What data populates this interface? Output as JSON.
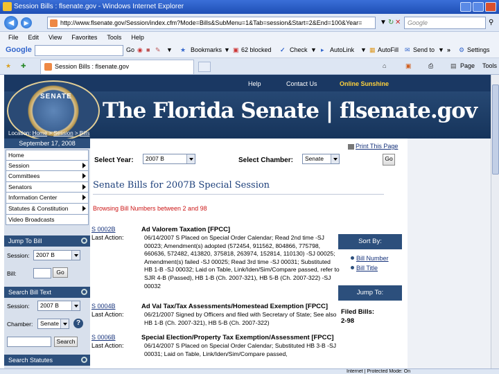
{
  "window": {
    "title": "Session Bills : flsenate.gov - Windows Internet Explorer"
  },
  "addressbar": {
    "url": "http://www.flsenate.gov/Session/index.cfm?Mode=Bills&SubMenu=1&Tab=session&Start=2&End=100&Year=",
    "search_placeholder": "Google"
  },
  "menu": [
    "File",
    "Edit",
    "View",
    "Favorites",
    "Tools",
    "Help"
  ],
  "google_toolbar": {
    "logo": "Google",
    "go": "Go",
    "bookmarks": "Bookmarks",
    "blocked": "62 blocked",
    "check": "Check",
    "autolink": "AutoLink",
    "autofill": "AutoFill",
    "sendto": "Send to",
    "more": "»",
    "settings": "Settings"
  },
  "tab": {
    "title": "Session Bills : flsenate.gov",
    "page": "Page",
    "tools": "Tools"
  },
  "site": {
    "nav": [
      "Help",
      "Contact Us",
      "Online Sunshine"
    ],
    "seal_text": "SENATE",
    "brand": "The Florida Senate | flsenate.gov",
    "location_label": "Location:",
    "crumbs": [
      "Home",
      "Session",
      "Bills"
    ],
    "crumb_sep": ">"
  },
  "leftnav": {
    "date": "September 17, 2008",
    "items": [
      "Home",
      "Session",
      "Committees",
      "Senators",
      "Information Center",
      "Statutes & Constitution",
      "Video Broadcasts"
    ],
    "jump_to_bill": {
      "header": "Jump To Bill",
      "session_label": "Session:",
      "session_value": "2007 B",
      "bill_label": "Bill:",
      "go": "Go"
    },
    "search_bill_text": {
      "header": "Search Bill Text",
      "session_label": "Session:",
      "session_value": "2007 B",
      "chamber_label": "Chamber:",
      "chamber_value": "Senate",
      "help": "?",
      "search": "Search"
    },
    "search_statutes": {
      "header": "Search Statutes"
    }
  },
  "main": {
    "print_page": "Print This Page",
    "select_year_label": "Select Year:",
    "select_year_value": "2007 B",
    "select_chamber_label": "Select Chamber:",
    "select_chamber_value": "Senate",
    "go": "Go",
    "heading": "Senate Bills for 2007B Special Session",
    "browsing": "Browsing Bill Numbers between 2 and 98",
    "last_action_label": "Last Action:",
    "bills": [
      {
        "number": "S 0002B",
        "title": "Ad Valorem Taxation [FPCC]",
        "desc": "06/14/2007 S Placed on Special Order Calendar; Read 2nd time -SJ 00023; Amendment(s) adopted (572454, 911562, 804866, 775798, 660636, 572482, 413820, 375818, 263974, 152814, 110130) -SJ 00025; Amendment(s) failed -SJ 00025; Read 3rd time -SJ 00031; Substituted HB 1-B -SJ 00032; Laid on Table, Link/Iden/Sim/Compare passed, refer to SJR 4-B (Passed), HB 1-B (Ch. 2007-321), HB 5-B (Ch. 2007-322) -SJ 00032"
      },
      {
        "number": "S 0004B",
        "title": "Ad Val Tax/Tax Assessments/Homestead Exemption [FPCC]",
        "desc": "06/21/2007 Signed by Officers and filed with Secretary of State; See also HB 1-B (Ch. 2007-321), HB 5-B (Ch. 2007-322)"
      },
      {
        "number": "S 0006B",
        "title": "Special Election/Property Tax Exemption/Assessment [FPCC]",
        "desc": "06/14/2007 S Placed on Special Order Calendar; Substituted HB 3-B -SJ 00031; Laid on Table, Link/Iden/Sim/Compare passed,"
      }
    ],
    "sort_by": {
      "header": "Sort By:",
      "links": [
        "Bill Number",
        "Bill Title"
      ]
    },
    "jump_to": {
      "header": "Jump To:",
      "filed_label": "Filed Bills:",
      "filed_range": "2-98"
    }
  },
  "statusbar": {
    "zone": "Internet | Protected Mode: On"
  }
}
